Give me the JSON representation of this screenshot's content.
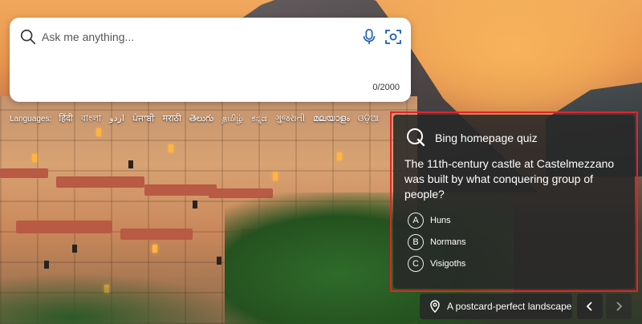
{
  "search": {
    "placeholder": "Ask me anything...",
    "char_count": "0/2000"
  },
  "languages": {
    "prefix": "Languages:",
    "items": [
      "हिंदी",
      "বাংলা",
      "اردو",
      "ਪੰਜਾਬੀ",
      "मराठी",
      "తెలుగు",
      "தமிழ்",
      "ಕನ್ನಡ",
      "ગુજરાતી",
      "മലയാളം",
      "ଓଡ଼ିଆ"
    ]
  },
  "quiz": {
    "title": "Bing homepage quiz",
    "question": "The 11th-century castle at Castelmezzano was built by what conquering group of people?",
    "options": [
      {
        "letter": "A",
        "text": "Huns"
      },
      {
        "letter": "B",
        "text": "Normans"
      },
      {
        "letter": "C",
        "text": "Visigoths"
      }
    ],
    "highlight_color": "#e0242b"
  },
  "caption": {
    "text": "A postcard-perfect landscape"
  },
  "icons": {
    "search": "search-icon",
    "mic": "microphone-icon",
    "camera": "visual-search-icon",
    "quiz": "quiz-q-icon",
    "location": "location-pin-icon",
    "prev": "chevron-left-icon",
    "next": "chevron-right-icon"
  }
}
